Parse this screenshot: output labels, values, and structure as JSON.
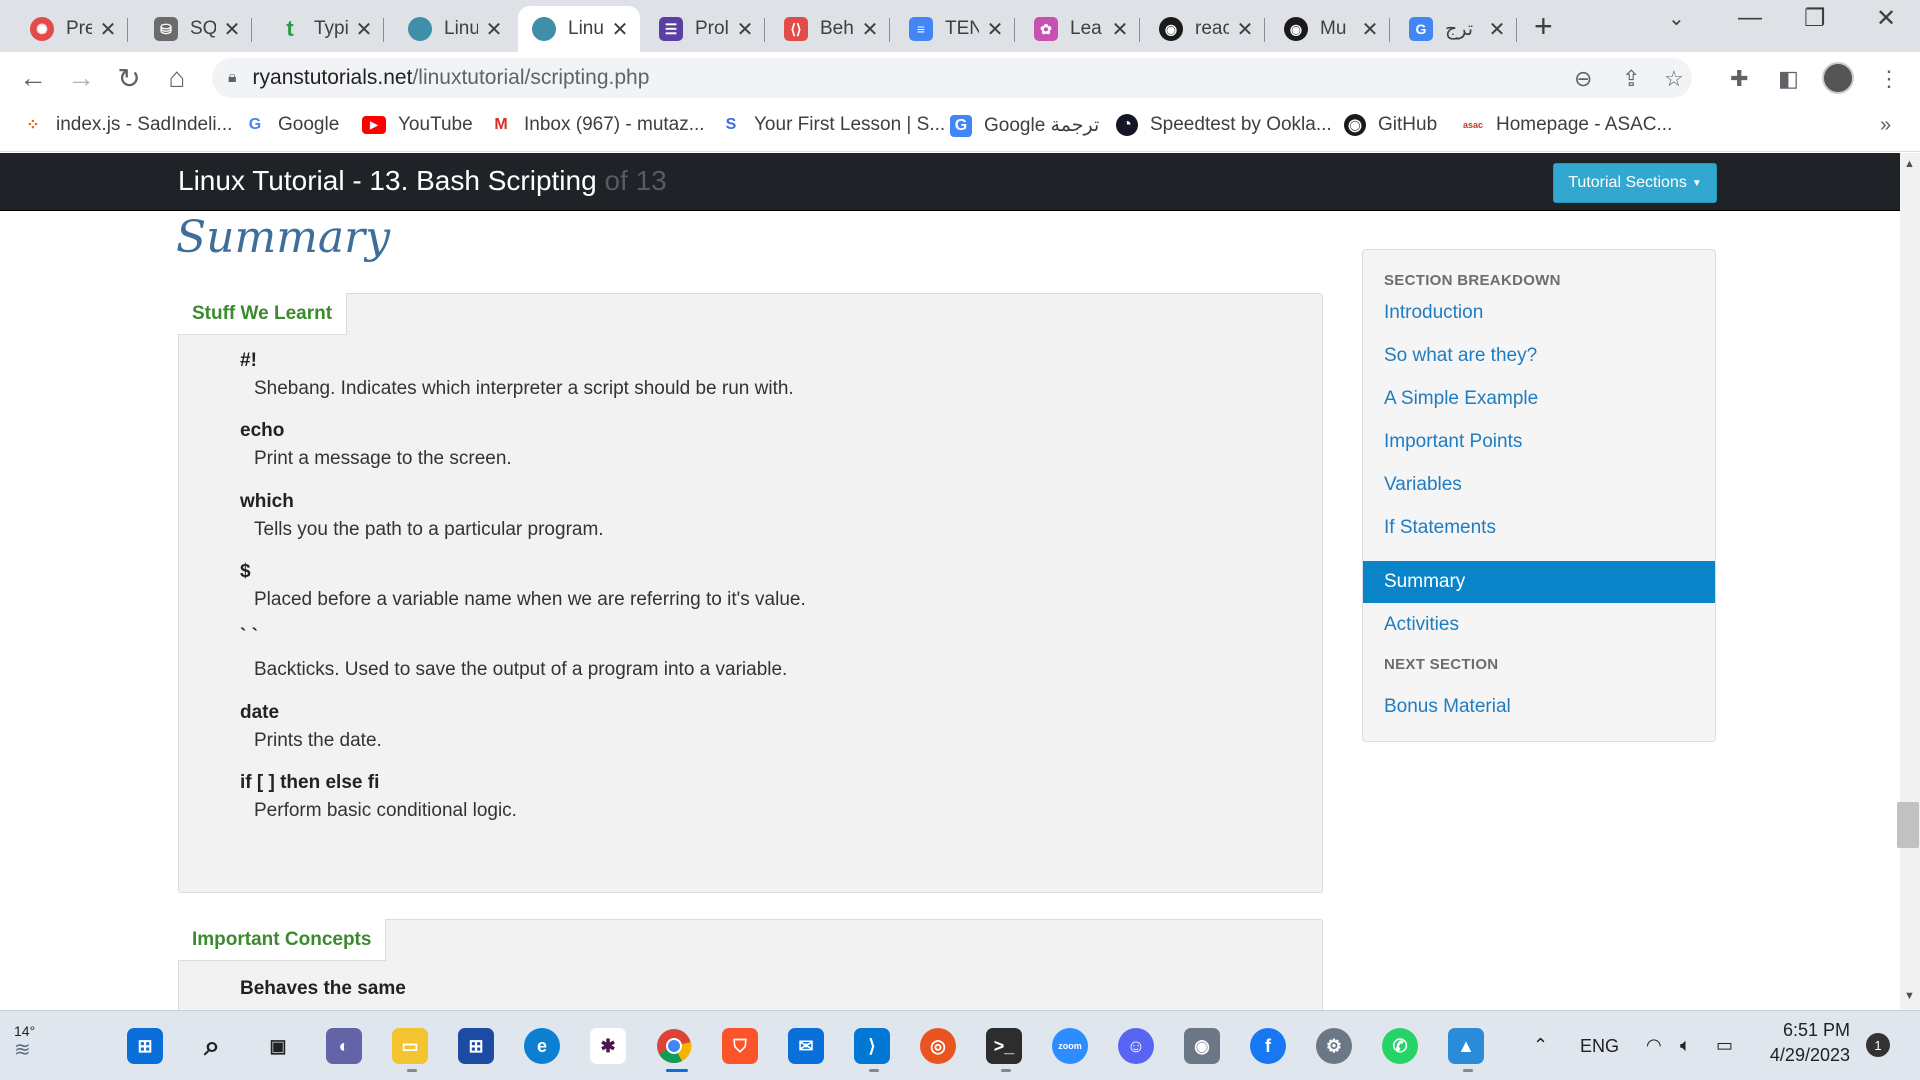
{
  "browser": {
    "tabs": [
      {
        "title": "Prep",
        "icon_color": "#e34b4b",
        "icon": "prep-icon"
      },
      {
        "title": "SQL",
        "icon_color": "#6b6b6b",
        "icon": "database-icon"
      },
      {
        "title": "Typi",
        "icon_color": "#2d9b45",
        "icon": "t-icon"
      },
      {
        "title": "Linu",
        "icon_color": "#3e8fa8",
        "icon": "ryan-icon"
      },
      {
        "title": "Linu",
        "icon_color": "#3e8fa8",
        "icon": "ryan-icon"
      },
      {
        "title": "Prol",
        "icon_color": "#5b3fa3",
        "icon": "forms-icon"
      },
      {
        "title": "Beh",
        "icon_color": "#e34b4b",
        "icon": "code-shield-icon"
      },
      {
        "title": "TEN",
        "icon_color": "#4285f4",
        "icon": "docs-icon"
      },
      {
        "title": "Lea",
        "icon_color": "#c94fb0",
        "icon": "colorful-icon"
      },
      {
        "title": "reac",
        "icon_color": "#1a1a1a",
        "icon": "github-icon"
      },
      {
        "title": "Mu",
        "icon_color": "#1a1a1a",
        "icon": "github-icon"
      },
      {
        "title": "ترج",
        "icon_color": "#4285f4",
        "icon": "translate-icon"
      }
    ],
    "url_domain": "ryanstutorials.net",
    "url_path": "/linuxtutorial/scripting.php",
    "bookmarks": [
      {
        "label": "index.js - SadIndeli...",
        "icon_color": "#f26207",
        "icon": "replit-icon"
      },
      {
        "label": "Google",
        "icon_color": "#4285f4",
        "icon": "google-icon"
      },
      {
        "label": "YouTube",
        "icon_color": "#ff0000",
        "icon": "youtube-icon"
      },
      {
        "label": "Inbox (967) - mutaz...",
        "icon_color": "#d93025",
        "icon": "gmail-icon"
      },
      {
        "label": "Your First Lesson | S...",
        "icon_color": "#3b6ce0",
        "icon": "swirl-icon"
      },
      {
        "label": "Google ترجمة",
        "icon_color": "#4285f4",
        "icon": "translate-icon"
      },
      {
        "label": "Speedtest by Ookla...",
        "icon_color": "#141526",
        "icon": "speedtest-icon"
      },
      {
        "label": "GitHub",
        "icon_color": "#1a1a1a",
        "icon": "github-icon"
      },
      {
        "label": "Homepage - ASAC...",
        "icon_color": "#c0392b",
        "icon": "asac-icon"
      }
    ]
  },
  "site": {
    "title_main": "Linux Tutorial - 13. Bash Scripting",
    "title_of": "of 13",
    "sections_button": "Tutorial Sections"
  },
  "content": {
    "heading": "Summary",
    "panel1_tab": "Stuff We Learnt",
    "items": [
      {
        "term": "#!",
        "desc": "Shebang. Indicates which interpreter a script should be run with."
      },
      {
        "term": "echo",
        "desc": "Print a message to the screen."
      },
      {
        "term": "which",
        "desc": "Tells you the path to a particular program."
      },
      {
        "term": "$",
        "desc": "Placed before a variable name when we are referring to it's value."
      },
      {
        "term": "` `",
        "desc": "Backticks. Used to save the output of a program into a variable."
      },
      {
        "term": "date",
        "desc": "Prints the date."
      },
      {
        "term": "if [ ] then else fi",
        "desc": "Perform basic conditional logic."
      }
    ],
    "panel2_tab": "Important Concepts",
    "panel2_first": "Behaves the same"
  },
  "sidebar": {
    "heading1": "SECTION BREAKDOWN",
    "links": [
      "Introduction",
      "So what are they?",
      "A Simple Example",
      "Important Points",
      "Variables",
      "If Statements",
      "Summary",
      "Activities"
    ],
    "active_index": 6,
    "heading2": "NEXT SECTION",
    "next_link": "Bonus Material"
  },
  "taskbar": {
    "weather": "14°",
    "lang": "ENG",
    "time": "6:51 PM",
    "date": "4/29/2023",
    "notifications": "1"
  },
  "colors": {
    "accent": "#0a84c8",
    "header_bg": "#1f2327",
    "panel_tab_text": "#3c8a2e",
    "heading_script": "#3f6e9a"
  }
}
